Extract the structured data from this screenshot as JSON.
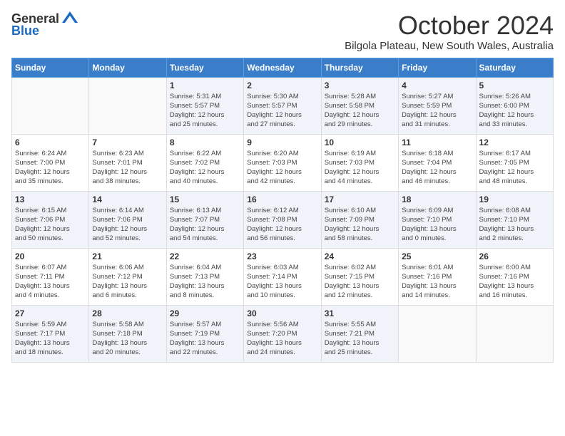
{
  "logo": {
    "general": "General",
    "blue": "Blue"
  },
  "title": "October 2024",
  "location": "Bilgola Plateau, New South Wales, Australia",
  "weekdays": [
    "Sunday",
    "Monday",
    "Tuesday",
    "Wednesday",
    "Thursday",
    "Friday",
    "Saturday"
  ],
  "weeks": [
    [
      {
        "day": "",
        "info": ""
      },
      {
        "day": "",
        "info": ""
      },
      {
        "day": "1",
        "info": "Sunrise: 5:31 AM\nSunset: 5:57 PM\nDaylight: 12 hours\nand 25 minutes."
      },
      {
        "day": "2",
        "info": "Sunrise: 5:30 AM\nSunset: 5:57 PM\nDaylight: 12 hours\nand 27 minutes."
      },
      {
        "day": "3",
        "info": "Sunrise: 5:28 AM\nSunset: 5:58 PM\nDaylight: 12 hours\nand 29 minutes."
      },
      {
        "day": "4",
        "info": "Sunrise: 5:27 AM\nSunset: 5:59 PM\nDaylight: 12 hours\nand 31 minutes."
      },
      {
        "day": "5",
        "info": "Sunrise: 5:26 AM\nSunset: 6:00 PM\nDaylight: 12 hours\nand 33 minutes."
      }
    ],
    [
      {
        "day": "6",
        "info": "Sunrise: 6:24 AM\nSunset: 7:00 PM\nDaylight: 12 hours\nand 35 minutes."
      },
      {
        "day": "7",
        "info": "Sunrise: 6:23 AM\nSunset: 7:01 PM\nDaylight: 12 hours\nand 38 minutes."
      },
      {
        "day": "8",
        "info": "Sunrise: 6:22 AM\nSunset: 7:02 PM\nDaylight: 12 hours\nand 40 minutes."
      },
      {
        "day": "9",
        "info": "Sunrise: 6:20 AM\nSunset: 7:03 PM\nDaylight: 12 hours\nand 42 minutes."
      },
      {
        "day": "10",
        "info": "Sunrise: 6:19 AM\nSunset: 7:03 PM\nDaylight: 12 hours\nand 44 minutes."
      },
      {
        "day": "11",
        "info": "Sunrise: 6:18 AM\nSunset: 7:04 PM\nDaylight: 12 hours\nand 46 minutes."
      },
      {
        "day": "12",
        "info": "Sunrise: 6:17 AM\nSunset: 7:05 PM\nDaylight: 12 hours\nand 48 minutes."
      }
    ],
    [
      {
        "day": "13",
        "info": "Sunrise: 6:15 AM\nSunset: 7:06 PM\nDaylight: 12 hours\nand 50 minutes."
      },
      {
        "day": "14",
        "info": "Sunrise: 6:14 AM\nSunset: 7:06 PM\nDaylight: 12 hours\nand 52 minutes."
      },
      {
        "day": "15",
        "info": "Sunrise: 6:13 AM\nSunset: 7:07 PM\nDaylight: 12 hours\nand 54 minutes."
      },
      {
        "day": "16",
        "info": "Sunrise: 6:12 AM\nSunset: 7:08 PM\nDaylight: 12 hours\nand 56 minutes."
      },
      {
        "day": "17",
        "info": "Sunrise: 6:10 AM\nSunset: 7:09 PM\nDaylight: 12 hours\nand 58 minutes."
      },
      {
        "day": "18",
        "info": "Sunrise: 6:09 AM\nSunset: 7:10 PM\nDaylight: 13 hours\nand 0 minutes."
      },
      {
        "day": "19",
        "info": "Sunrise: 6:08 AM\nSunset: 7:10 PM\nDaylight: 13 hours\nand 2 minutes."
      }
    ],
    [
      {
        "day": "20",
        "info": "Sunrise: 6:07 AM\nSunset: 7:11 PM\nDaylight: 13 hours\nand 4 minutes."
      },
      {
        "day": "21",
        "info": "Sunrise: 6:06 AM\nSunset: 7:12 PM\nDaylight: 13 hours\nand 6 minutes."
      },
      {
        "day": "22",
        "info": "Sunrise: 6:04 AM\nSunset: 7:13 PM\nDaylight: 13 hours\nand 8 minutes."
      },
      {
        "day": "23",
        "info": "Sunrise: 6:03 AM\nSunset: 7:14 PM\nDaylight: 13 hours\nand 10 minutes."
      },
      {
        "day": "24",
        "info": "Sunrise: 6:02 AM\nSunset: 7:15 PM\nDaylight: 13 hours\nand 12 minutes."
      },
      {
        "day": "25",
        "info": "Sunrise: 6:01 AM\nSunset: 7:16 PM\nDaylight: 13 hours\nand 14 minutes."
      },
      {
        "day": "26",
        "info": "Sunrise: 6:00 AM\nSunset: 7:16 PM\nDaylight: 13 hours\nand 16 minutes."
      }
    ],
    [
      {
        "day": "27",
        "info": "Sunrise: 5:59 AM\nSunset: 7:17 PM\nDaylight: 13 hours\nand 18 minutes."
      },
      {
        "day": "28",
        "info": "Sunrise: 5:58 AM\nSunset: 7:18 PM\nDaylight: 13 hours\nand 20 minutes."
      },
      {
        "day": "29",
        "info": "Sunrise: 5:57 AM\nSunset: 7:19 PM\nDaylight: 13 hours\nand 22 minutes."
      },
      {
        "day": "30",
        "info": "Sunrise: 5:56 AM\nSunset: 7:20 PM\nDaylight: 13 hours\nand 24 minutes."
      },
      {
        "day": "31",
        "info": "Sunrise: 5:55 AM\nSunset: 7:21 PM\nDaylight: 13 hours\nand 25 minutes."
      },
      {
        "day": "",
        "info": ""
      },
      {
        "day": "",
        "info": ""
      }
    ]
  ]
}
